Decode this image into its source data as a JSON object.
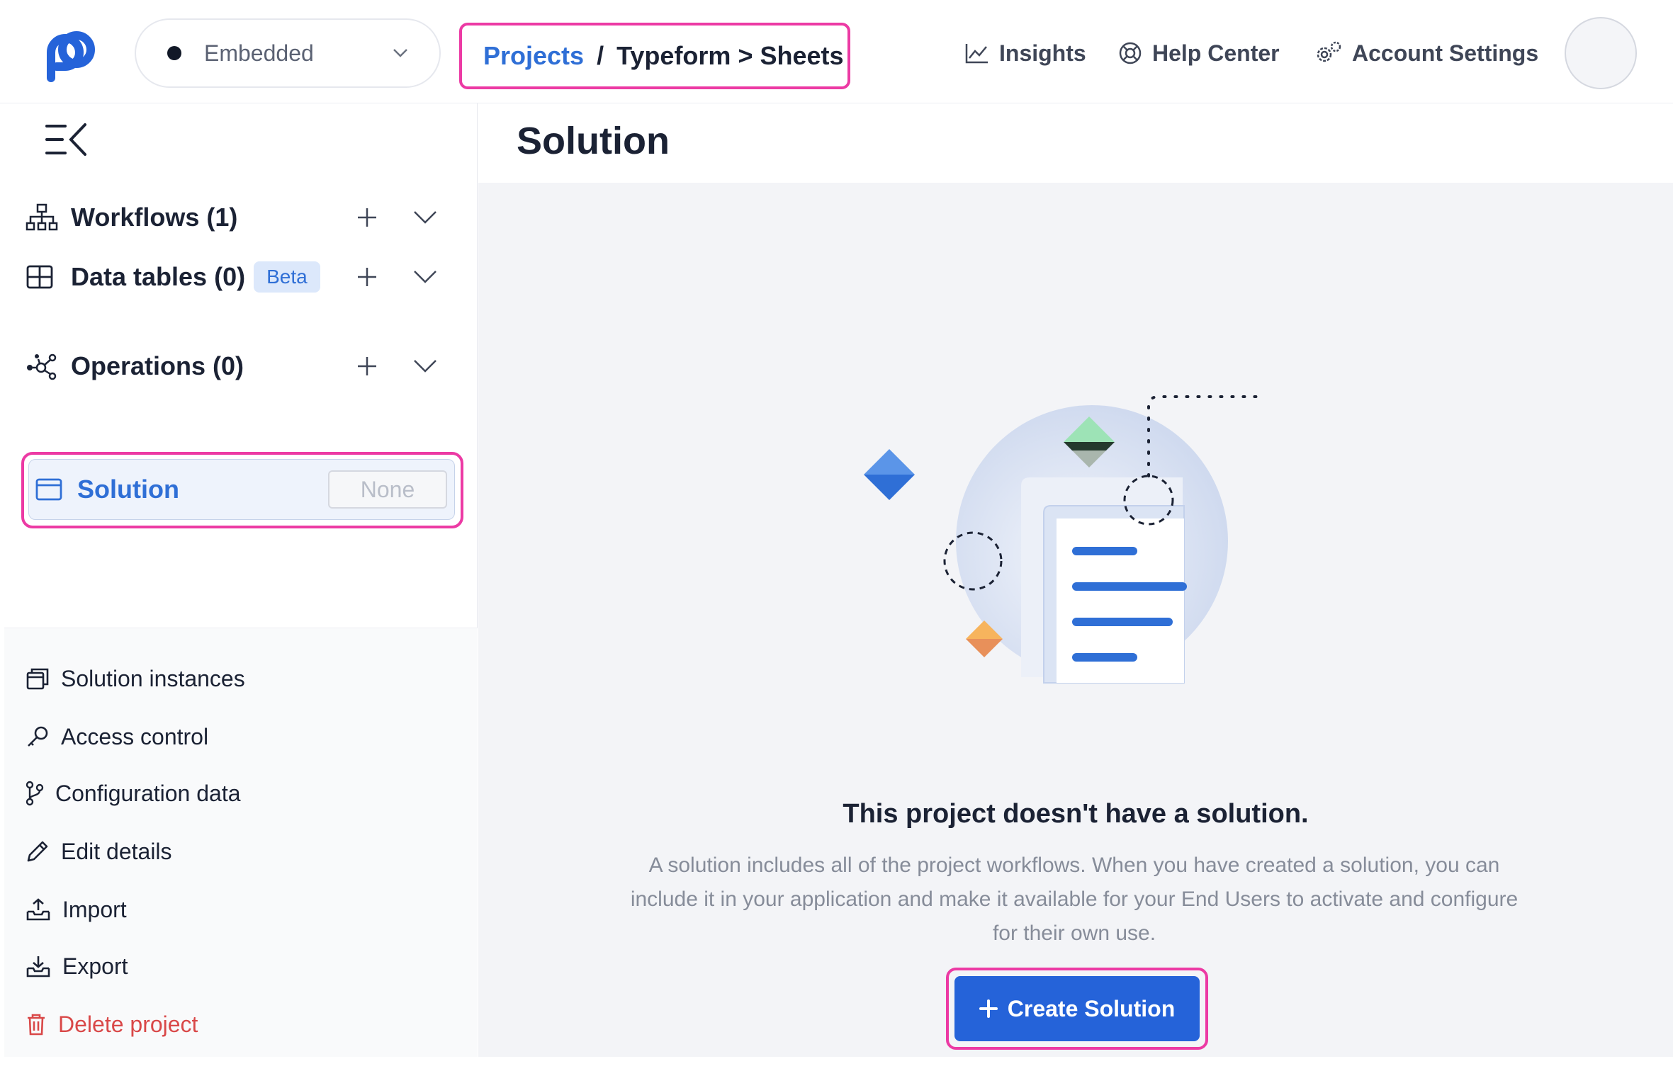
{
  "topbar": {
    "environment": "Embedded",
    "breadcrumb": {
      "root": "Projects",
      "separator": "/",
      "current": "Typeform > Sheets"
    },
    "nav": {
      "insights": "Insights",
      "help_center": "Help Center",
      "account_settings": "Account Settings"
    }
  },
  "sidebar": {
    "sections": {
      "workflows": "Workflows (1)",
      "data_tables": "Data tables (0)",
      "data_tables_badge": "Beta",
      "operations": "Operations (0)"
    },
    "solution": {
      "label": "Solution",
      "value": "None"
    },
    "bottom": {
      "solution_instances": "Solution instances",
      "access_control": "Access control",
      "configuration_data": "Configuration data",
      "edit_details": "Edit details",
      "import": "Import",
      "export": "Export",
      "delete_project": "Delete project"
    }
  },
  "main": {
    "title": "Solution",
    "empty_title": "This project doesn't have a solution.",
    "empty_description": "A solution includes all of the project workflows. When you have created a solution, you can include it in your application and make it available for your End Users to activate and configure for their own use.",
    "create_button": "Create Solution"
  },
  "colors": {
    "accent": "#2563d9",
    "link": "#2f6fd6",
    "highlight": "#ec3aa4",
    "danger": "#d94848"
  }
}
